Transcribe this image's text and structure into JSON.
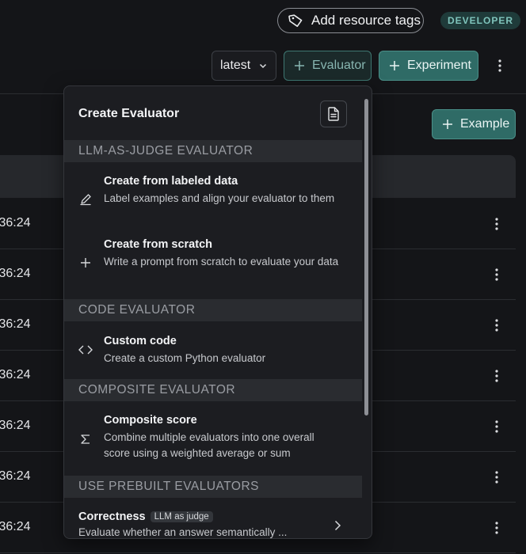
{
  "header": {
    "add_tags_label": "Add resource tags",
    "badge": "DEVELOPER",
    "version_select": "latest",
    "evaluator_button": "Evaluator",
    "experiment_button": "Experiment",
    "example_button": "Example"
  },
  "table": {
    "row_times": [
      ":36:24",
      ":36:24",
      ":36:24",
      ":36:24",
      ":36:24",
      ":36:24",
      ":36:24"
    ]
  },
  "dropdown": {
    "title": "Create Evaluator",
    "sections": {
      "llm": "LLM-AS-JUDGE EVALUATOR",
      "code": "CODE EVALUATOR",
      "composite": "COMPOSITE EVALUATOR",
      "prebuilt": "USE PREBUILT EVALUATORS"
    },
    "items": {
      "labeled": {
        "title": "Create from labeled data",
        "desc": "Label examples and align your evaluator to them"
      },
      "scratch": {
        "title": "Create from scratch",
        "desc": "Write a prompt from scratch to evaluate your data"
      },
      "custom": {
        "title": "Custom code",
        "desc": "Create a custom Python evaluator"
      },
      "composite": {
        "title": "Composite score",
        "desc": "Combine multiple evaluators into one overall score using a weighted average or sum"
      },
      "correctness": {
        "title": "Correctness",
        "pill": "LLM as judge",
        "desc": "Evaluate whether an answer semantically ..."
      }
    }
  },
  "icons": {
    "tag": "tag-icon",
    "chevron": "chevron-down-icon",
    "plus": "plus-icon",
    "kebab": "kebab-icon",
    "doc": "document-icon",
    "pencil": "pencil-icon",
    "code": "code-brackets-icon",
    "sigma": "sigma-icon",
    "chevron_right": "chevron-right-icon"
  },
  "colors": {
    "accent": "#2f6b66",
    "accent_border": "#4a8f88",
    "badge_text": "#7fc4bc",
    "background": "#141518"
  }
}
